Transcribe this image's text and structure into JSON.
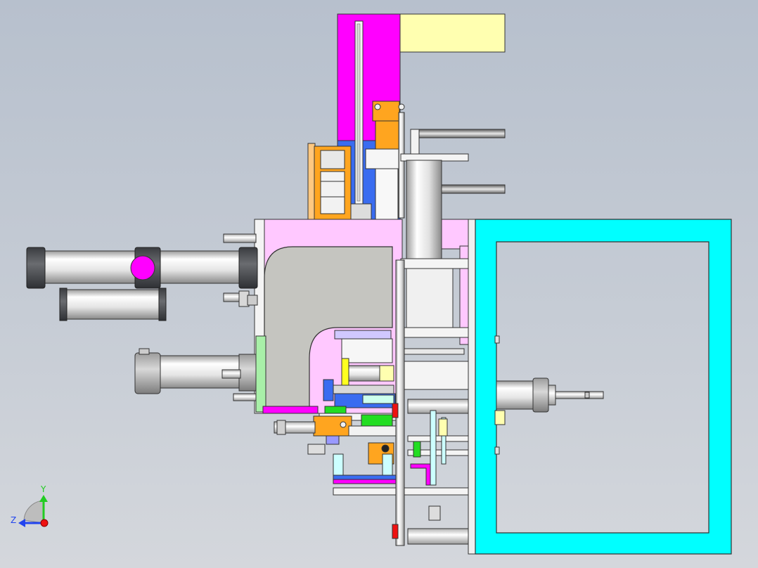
{
  "viewport": {
    "background_top": "#b7c0cd",
    "background_bottom": "#d4d7dc"
  },
  "palette": {
    "magenta": "#ff00ff",
    "cyan": "#00ffff",
    "orange": "#ffa51f",
    "blue": "#3a6cf0",
    "light_yellow": "#ffffb0",
    "gray_plate": "#c5c5c0",
    "dark_steel": "#4d4f54",
    "pale_pink": "#ffc8ff",
    "light_green": "#a8f0a8",
    "green": "#22dd22",
    "yellow": "#ffff20",
    "red": "#ee1111",
    "white_steel": "#f2f2f2"
  },
  "triad": {
    "y_label": "Y",
    "z_label": "Z",
    "y_color": "#22cc22",
    "z_color": "#2244ee",
    "origin_color": "#ee1111"
  }
}
